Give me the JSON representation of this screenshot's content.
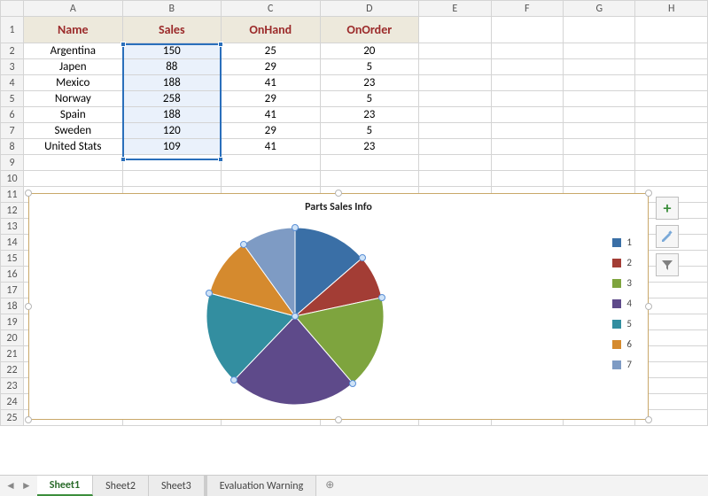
{
  "columns": [
    "A",
    "B",
    "C",
    "D",
    "E",
    "F",
    "G",
    "H"
  ],
  "headers": {
    "name": "Name",
    "sales": "Sales",
    "onhand": "OnHand",
    "onorder": "OnOrder"
  },
  "rows": [
    {
      "name": "Argentina",
      "sales": "150",
      "onhand": "25",
      "onorder": "20"
    },
    {
      "name": "Japen",
      "sales": "88",
      "onhand": "29",
      "onorder": "5"
    },
    {
      "name": "Mexico",
      "sales": "188",
      "onhand": "41",
      "onorder": "23"
    },
    {
      "name": "Norway",
      "sales": "258",
      "onhand": "29",
      "onorder": "5"
    },
    {
      "name": "Spain",
      "sales": "188",
      "onhand": "41",
      "onorder": "23"
    },
    {
      "name": "Sweden",
      "sales": "120",
      "onhand": "29",
      "onorder": "5"
    },
    {
      "name": "United Stats",
      "sales": "109",
      "onhand": "41",
      "onorder": "23"
    }
  ],
  "chart": {
    "title": "Parts Sales Info",
    "legend": [
      "1",
      "2",
      "3",
      "4",
      "5",
      "6",
      "7"
    ],
    "colors": [
      "#3a6fa6",
      "#a33d35",
      "#7ea43e",
      "#5e4a8a",
      "#338ea0",
      "#d58a2e",
      "#7e9bc4"
    ]
  },
  "chart_data": {
    "type": "pie",
    "title": "Parts Sales Info",
    "series": [
      {
        "name": "1",
        "value": 150
      },
      {
        "name": "2",
        "value": 88
      },
      {
        "name": "3",
        "value": 188
      },
      {
        "name": "4",
        "value": 258
      },
      {
        "name": "5",
        "value": 188
      },
      {
        "name": "6",
        "value": 120
      },
      {
        "name": "7",
        "value": 109
      }
    ]
  },
  "tabs": {
    "sheet1": "Sheet1",
    "sheet2": "Sheet2",
    "sheet3": "Sheet3",
    "warn": "Evaluation Warning"
  }
}
